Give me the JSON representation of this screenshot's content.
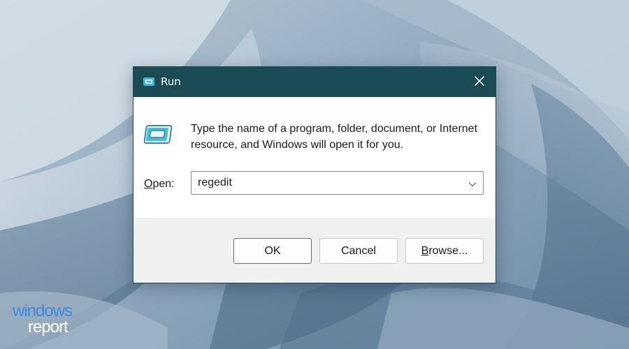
{
  "window": {
    "title": "Run",
    "title_icon": "run-icon",
    "close_icon": "close-icon"
  },
  "content": {
    "icon": "run-icon",
    "message": "Type the name of a program, folder, document, or Internet resource, and Windows will open it for you.",
    "open_label_prefix": "O",
    "open_label_rest": "pen:",
    "open_value": "regedit",
    "dropdown_icon": "chevron-down-icon"
  },
  "buttons": {
    "ok": "OK",
    "cancel": "Cancel",
    "browse_prefix": "B",
    "browse_rest": "rowse..."
  },
  "watermark": {
    "line1": "windows",
    "line2": "report"
  },
  "colors": {
    "titlebar": "#1b4b55",
    "accent_icon": "#3db8d8",
    "watermark_blue": "#3d8be0"
  }
}
